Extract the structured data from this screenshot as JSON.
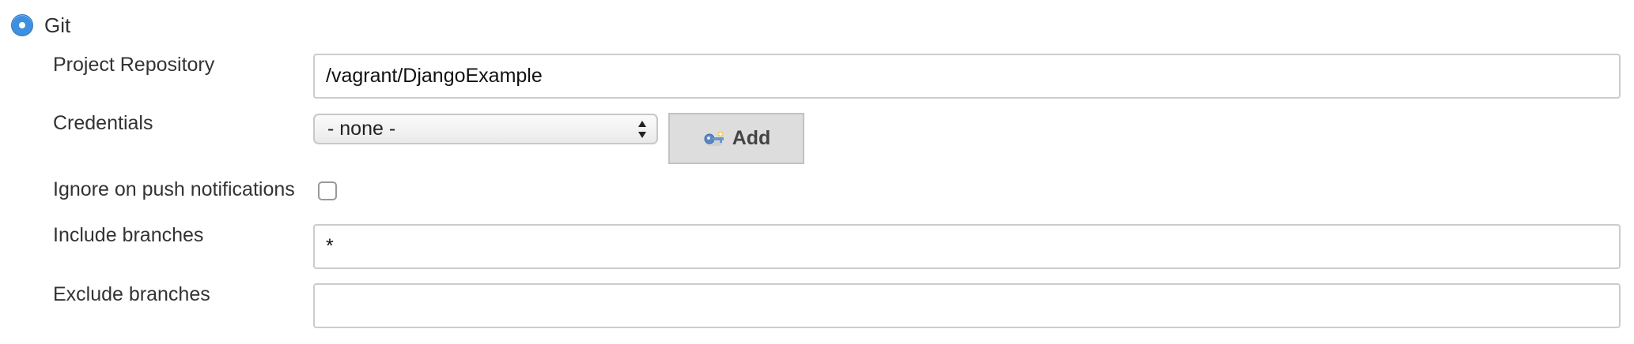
{
  "scm": {
    "option_label": "Git",
    "selected": true
  },
  "fields": {
    "project_repository": {
      "label": "Project Repository",
      "value": "/vagrant/DjangoExample"
    },
    "credentials": {
      "label": "Credentials",
      "selected": "- none -",
      "add_button_label": "Add",
      "add_button_icon": "key-icon"
    },
    "ignore_push": {
      "label": "Ignore on push notifications",
      "checked": false
    },
    "include_branches": {
      "label": "Include branches",
      "value": "*"
    },
    "exclude_branches": {
      "label": "Exclude branches",
      "value": ""
    }
  },
  "colors": {
    "radio_accent": "#3d8fe0",
    "input_border": "#cccccc",
    "button_bg": "#dddddd",
    "text": "#333333"
  }
}
